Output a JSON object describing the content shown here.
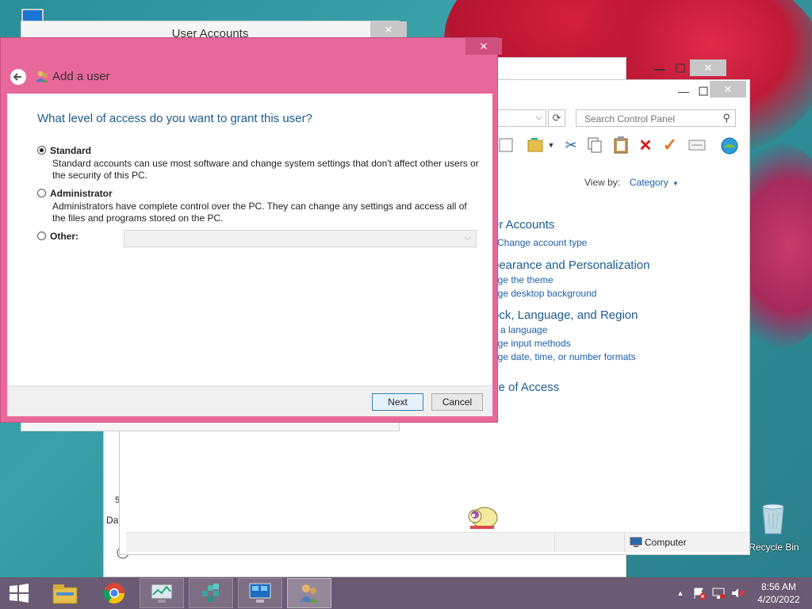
{
  "desktop": {
    "recycle_bin_label": "Recycle Bin"
  },
  "control_panel": {
    "search_placeholder": "Search Control Panel",
    "view_by_label": "View by:",
    "view_by_value": "Category",
    "categories": [
      {
        "title": "er Accounts",
        "links": [
          "Change account type"
        ]
      },
      {
        "title": "pearance and Personalization",
        "links": [
          "nge the theme",
          "nge desktop background"
        ]
      },
      {
        "title": "ock, Language, and Region",
        "links": [
          "d a language",
          "nge input methods",
          "nge date, time, or number formats"
        ]
      },
      {
        "title": "se of Access",
        "links": []
      }
    ],
    "status_computer": "Computer"
  },
  "bg_window": {
    "frag_5": "5",
    "frag_dat": "Dat"
  },
  "user_accounts_window": {
    "title": "User Accounts"
  },
  "dialog": {
    "header_title": "Add a user",
    "question": "What level of access do you want to grant this user?",
    "options": [
      {
        "label": "Standard",
        "desc": "Standard accounts can use most software and change system settings that don't affect other users or the security of this PC.",
        "selected": true
      },
      {
        "label": "Administrator",
        "desc": "Administrators have complete control over the PC. They can change any settings and access all of the files and programs stored on the PC.",
        "selected": false
      },
      {
        "label": "Other:",
        "desc": "",
        "selected": false
      }
    ],
    "next_label": "Next",
    "cancel_label": "Cancel"
  },
  "taskbar": {
    "time": "8:56 AM",
    "date": "4/20/2022"
  },
  "colors": {
    "dialog_frame": "#e8689a",
    "taskbar": "#6b5a73",
    "heading_blue": "#1c5b8f",
    "link_blue": "#1e5fa8"
  }
}
